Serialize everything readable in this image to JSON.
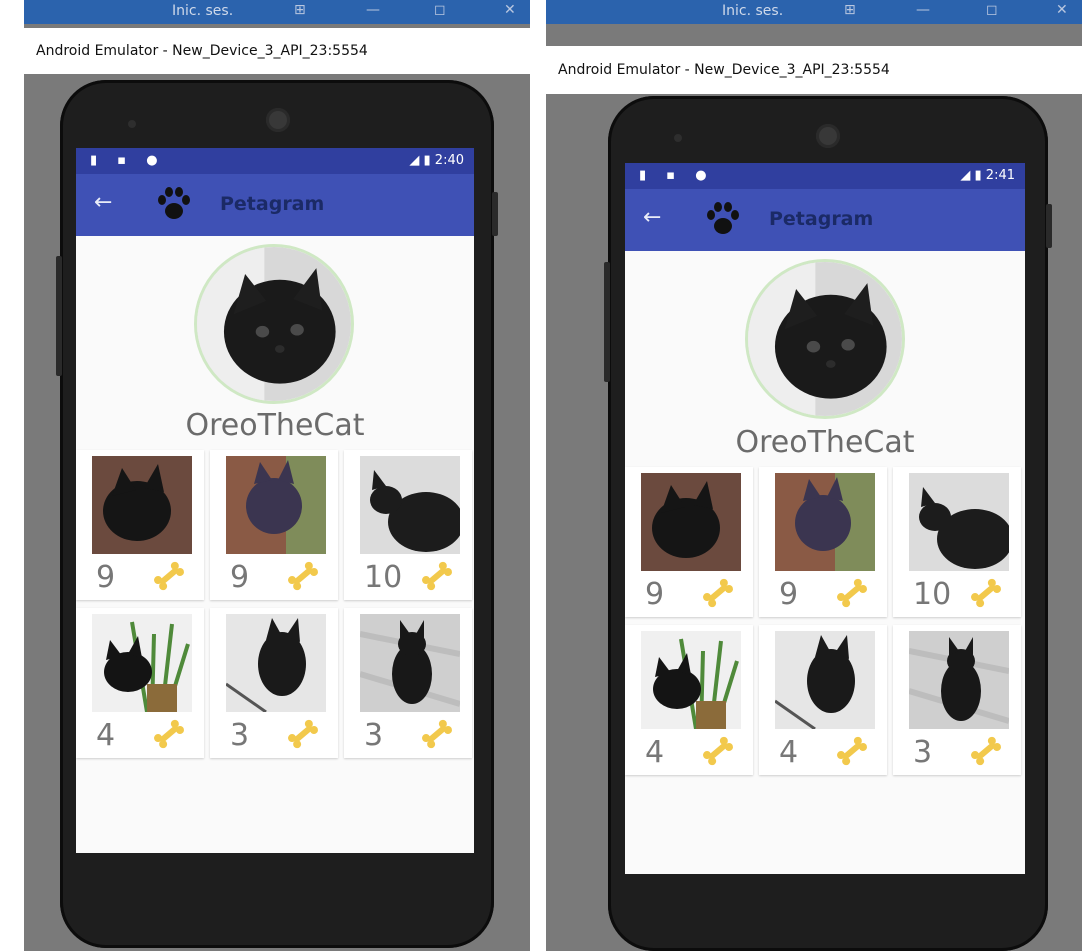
{
  "windows": [
    {
      "taskbar_label": "Inic. ses.",
      "window_title": "Android Emulator - New_Device_3_API_23:5554",
      "time": "2:40",
      "app_title": "Petagram",
      "username": "OreoTheCat",
      "posts": [
        {
          "likes": "9"
        },
        {
          "likes": "9"
        },
        {
          "likes": "10"
        },
        {
          "likes": "4"
        },
        {
          "likes": "3"
        },
        {
          "likes": "3"
        }
      ]
    },
    {
      "taskbar_label": "Inic. ses.",
      "window_title": "Android Emulator - New_Device_3_API_23:5554",
      "time": "2:41",
      "app_title": "Petagram",
      "username": "OreoTheCat",
      "posts": [
        {
          "likes": "9"
        },
        {
          "likes": "9"
        },
        {
          "likes": "10"
        },
        {
          "likes": "4"
        },
        {
          "likes": "4"
        },
        {
          "likes": "3"
        }
      ]
    }
  ],
  "icons": {
    "back": "arrow-left-icon",
    "logo": "paw-icon",
    "like": "bone-icon"
  },
  "colors": {
    "status_bar": "#303f9f",
    "app_bar": "#3f51b5",
    "bone": "#f2c94c"
  }
}
